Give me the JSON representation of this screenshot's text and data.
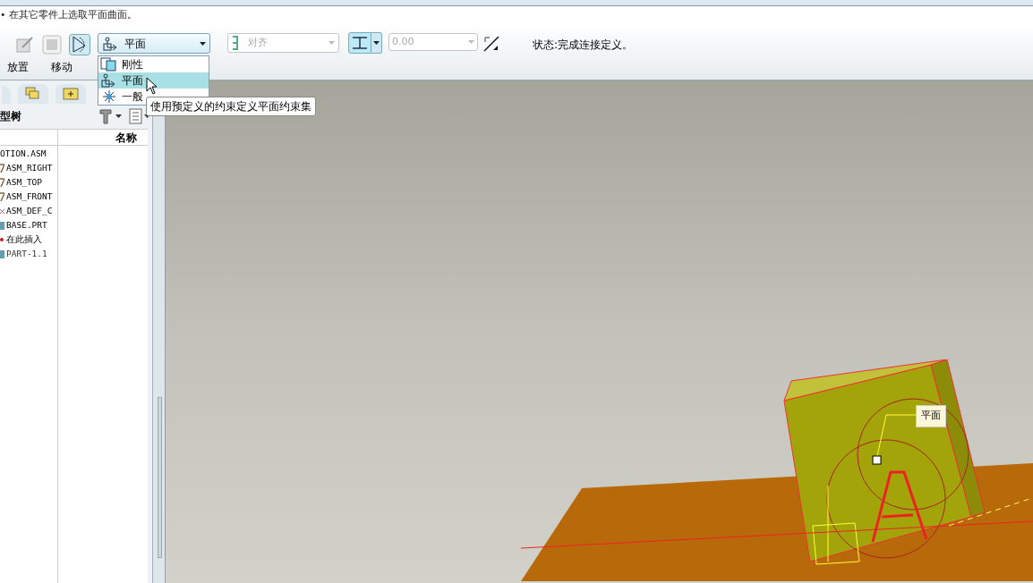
{
  "prompt": "• 在其它零件上选取平面曲面。",
  "toolbar": {
    "constraint_type": {
      "value": "平面",
      "options": [
        {
          "label": "刚性",
          "kind": "rigid",
          "selected": false
        },
        {
          "label": "平面",
          "kind": "planar",
          "selected": true
        },
        {
          "label": "一般",
          "kind": "general",
          "selected": false
        }
      ],
      "tooltip": "使用预定义的约束定义平面约束集"
    },
    "align": {
      "value": "对齐",
      "disabled": true
    },
    "offset": {
      "value": "0.00",
      "disabled": true
    },
    "status": "状态:完成连接定义。"
  },
  "tabs": [
    {
      "label": "放置",
      "selected": false
    },
    {
      "label": "移动",
      "selected": false
    }
  ],
  "model_tree": {
    "title": "型树",
    "column": "名称",
    "items": [
      {
        "label": "OTION.ASM",
        "kind": "asm"
      },
      {
        "label": "ASM_RIGHT",
        "kind": "datum"
      },
      {
        "label": "ASM_TOP",
        "kind": "datum"
      },
      {
        "label": "ASM_FRONT",
        "kind": "datum"
      },
      {
        "label": "ASM_DEF_C",
        "kind": "csys"
      },
      {
        "label": "BASE.PRT",
        "kind": "part"
      },
      {
        "label": "在此插入",
        "kind": "insert"
      },
      {
        "label": "PART-1.1",
        "kind": "part_new"
      }
    ]
  },
  "viewport": {
    "callout": "平面"
  }
}
